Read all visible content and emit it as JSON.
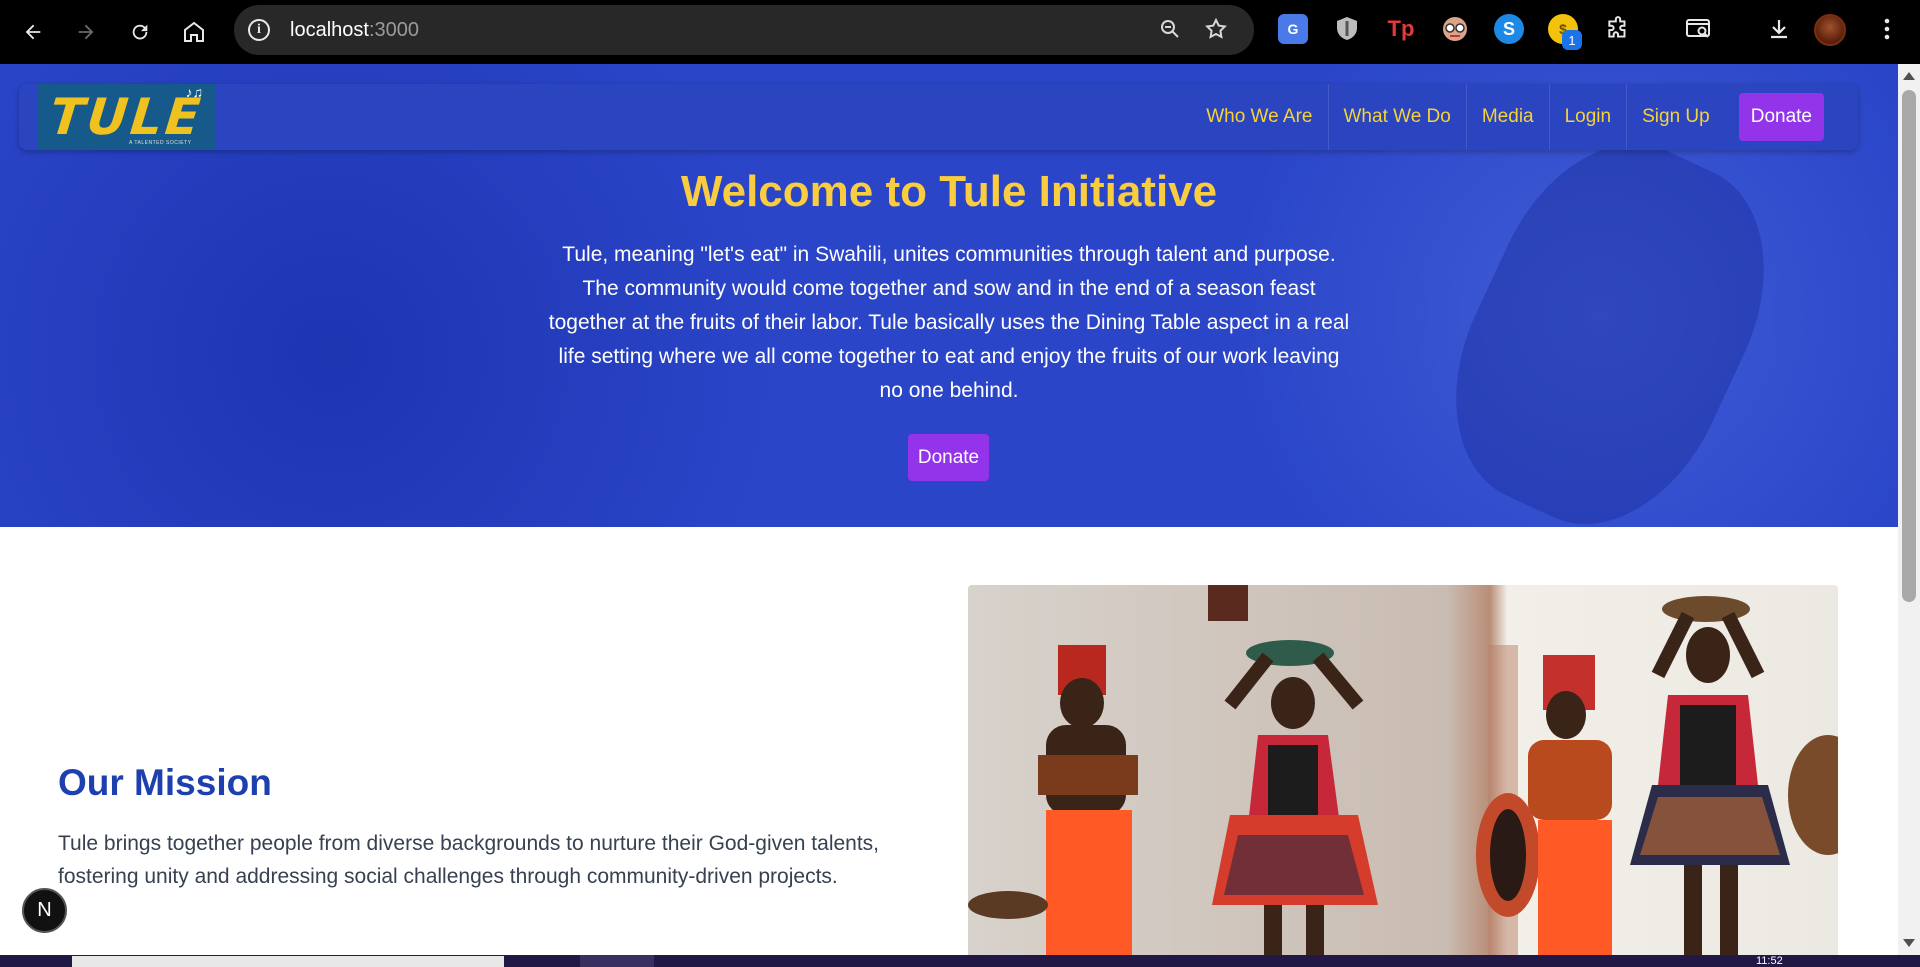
{
  "browser": {
    "url_host": "localhost",
    "url_port": ":3000",
    "extension_badge": "1"
  },
  "nav": {
    "logo_text": "TULE",
    "logo_tagline": "A TALENTED SOCIETY",
    "items": [
      "Who We Are",
      "What We Do",
      "Media",
      "Login",
      "Sign Up"
    ],
    "donate_label": "Donate"
  },
  "hero": {
    "title": "Welcome to Tule Initiative",
    "text": "Tule, meaning \"let's eat\" in Swahili, unites communities through talent and purpose. The community would come together and sow and in the end of a season feast together at the fruits of their labor. Tule basically uses the Dining Table aspect in a real life setting where we all come together to eat and enjoy the fruits of our work leaving no one behind.",
    "donate_label": "Donate"
  },
  "mission": {
    "title": "Our Mission",
    "text": "Tule brings together people from diverse backgrounds to nurture their God-given talents, fostering unity and addressing social challenges through community-driven projects."
  },
  "dev_badge": "N",
  "taskbar": {
    "clock": "11:52"
  },
  "colors": {
    "hero_bg": "#2a45c8",
    "title_yellow": "#facc3f",
    "button_purple": "#9333ea",
    "mission_blue": "#1e40af"
  }
}
